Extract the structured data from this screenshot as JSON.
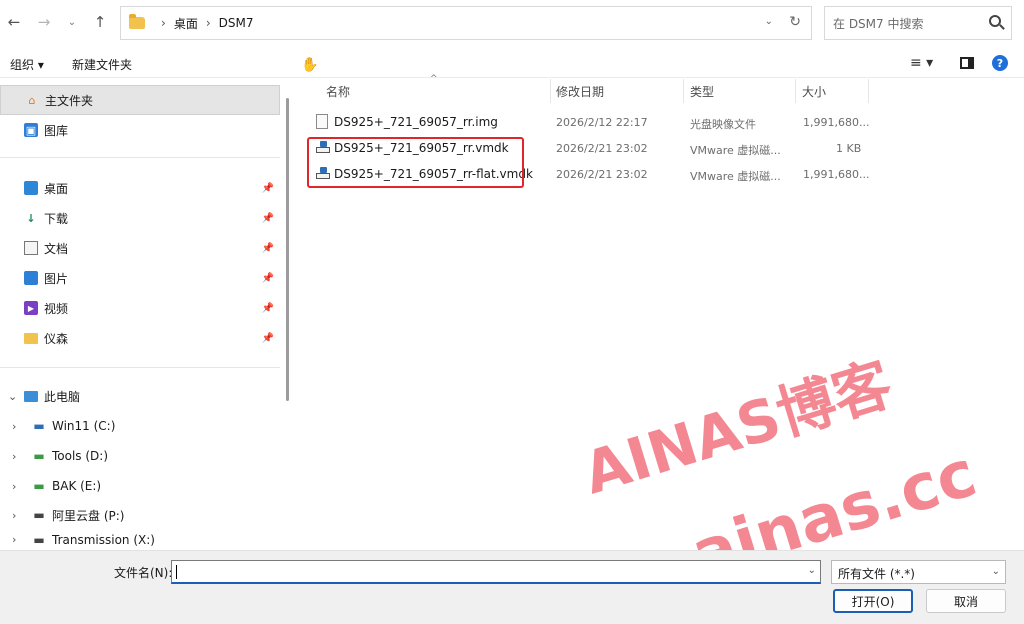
{
  "nav": {
    "breadcrumb": [
      "桌面",
      "DSM7"
    ],
    "search_placeholder": "在 DSM7 中搜索"
  },
  "toolbar": {
    "organize_label": "组织 ▾",
    "new_folder_label": "新建文件夹"
  },
  "sidebar": {
    "top_items": [
      {
        "label": "主文件夹",
        "icon": "home-icon"
      },
      {
        "label": "图库",
        "icon": "gallery-icon"
      }
    ],
    "quick_access": [
      {
        "label": "桌面",
        "icon": "desktop-icon"
      },
      {
        "label": "下载",
        "icon": "download-icon"
      },
      {
        "label": "文档",
        "icon": "document-icon"
      },
      {
        "label": "图片",
        "icon": "pictures-icon"
      },
      {
        "label": "视频",
        "icon": "videos-icon"
      },
      {
        "label": "仪森",
        "icon": "folder-icon"
      }
    ],
    "this_pc_label": "此电脑",
    "drives": [
      {
        "label": "Win11 (C:)",
        "icon": "windows-drive-icon"
      },
      {
        "label": "Tools (D:)",
        "icon": "drive-icon"
      },
      {
        "label": "BAK (E:)",
        "icon": "drive-icon"
      },
      {
        "label": "阿里云盘 (P:)",
        "icon": "drive-icon"
      },
      {
        "label": "Transmission (X:)",
        "icon": "drive-icon"
      }
    ]
  },
  "columns": {
    "name": "名称",
    "date": "修改日期",
    "type": "类型",
    "size": "大小"
  },
  "files": [
    {
      "name": "DS925+_721_69057_rr.img",
      "date": "2026/2/12 22:17",
      "type": "光盘映像文件",
      "size": "1,991,680..."
    },
    {
      "name": "DS925+_721_69057_rr.vmdk",
      "date": "2026/2/21 23:02",
      "type": "VMware 虚拟磁...",
      "size": "1 KB"
    },
    {
      "name": "DS925+_721_69057_rr-flat.vmdk",
      "date": "2026/2/21 23:02",
      "type": "VMware 虚拟磁...",
      "size": "1,991,680..."
    }
  ],
  "bottom": {
    "filename_label": "文件名(N):",
    "filename_value": "",
    "filetype_value": "所有文件 (*.*)",
    "open_label": "打开(O)",
    "cancel_label": "取消"
  },
  "watermark": {
    "line1": "AINAS博客",
    "line2": "wp.ainas.cc"
  },
  "colors": {
    "accent": "#1a5fb4",
    "highlight_box": "#e0262a",
    "watermark": "#f0606e"
  }
}
